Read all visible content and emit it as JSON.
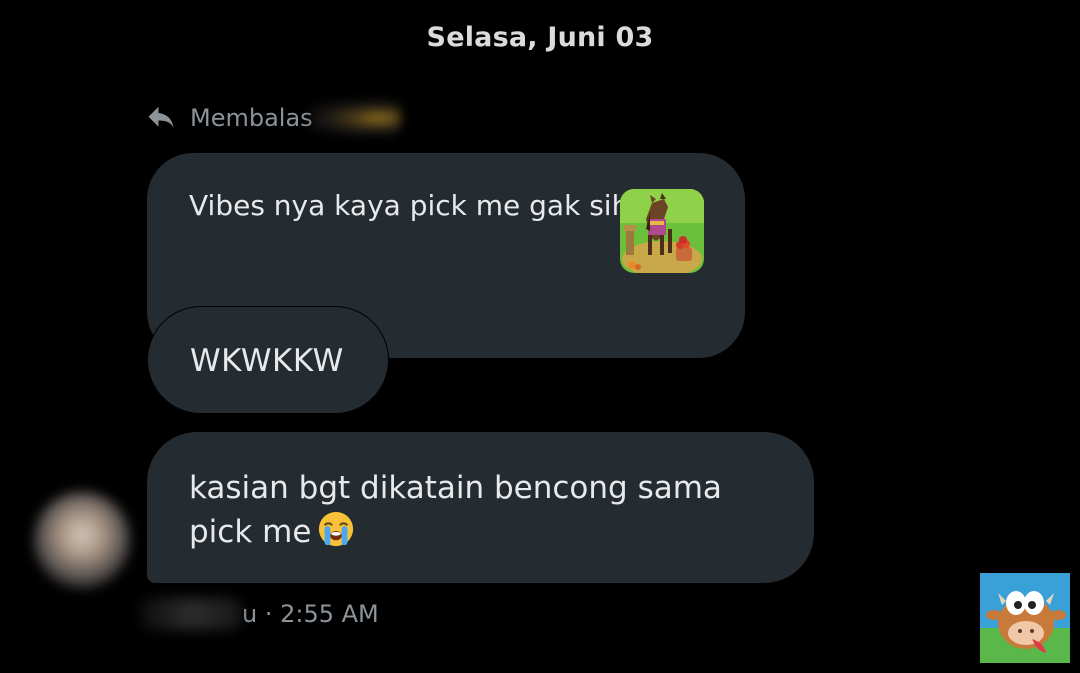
{
  "date_header": "Selasa, Juni 03",
  "reply": {
    "icon": "reply-arrow-icon",
    "label": "Membalas"
  },
  "messages": [
    {
      "text": "Vibes nya kaya pick me gak sih",
      "attachment": "farm-horse-sticker"
    },
    {
      "text": "WKWKKW"
    },
    {
      "text": "kasian bgt dikatain bencong sama pick me",
      "emoji": "loudly-crying-face-icon"
    }
  ],
  "meta": {
    "name_tail": "u",
    "separator": " · ",
    "time": "2:55 AM"
  },
  "colors": {
    "background": "#000000",
    "bubble": "#242b31",
    "secondary_text": "#8b9298",
    "primary_text": "#e7e9ea"
  }
}
